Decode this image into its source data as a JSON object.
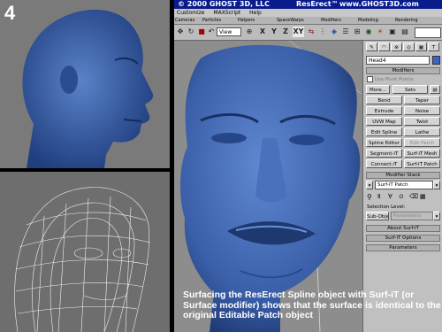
{
  "panel_number": "4",
  "window": {
    "title_left": "© 2000 GHOST 3D, LLC",
    "title_center": "ResErect™",
    "title_right": "www.GHOST3D.com"
  },
  "menu": [
    "Customize",
    "MAXScript",
    "Help"
  ],
  "tabs": [
    "Cameras",
    "Particles",
    "Helpers",
    "SpaceWarps",
    "Modifiers",
    "Modeling",
    "Rendering"
  ],
  "toolbar": {
    "view_select": "View",
    "axis_x": "X",
    "axis_y": "Y",
    "axis_z": "Z",
    "axis_xy": "XY"
  },
  "command_panel": {
    "object_name": "Head4",
    "modifiers_header": "Modifiers",
    "use_pivot_points": "Use Pivot Points",
    "more_label": "More...",
    "sets_label": "Sets",
    "modifier_buttons": [
      [
        "Bend",
        "Taper"
      ],
      [
        "Extrude",
        "Noise"
      ],
      [
        "UVW Map",
        "Twist"
      ],
      [
        "Edit Spline",
        "Lathe"
      ],
      [
        "Spline Editor",
        "Edit Patch"
      ],
      [
        "Segment-iT",
        "Surf-iT Mesh"
      ],
      [
        "Connect-iT",
        "Surf-iT Patch"
      ]
    ],
    "modifier_stack_header": "Modifier Stack",
    "stack_current": "Surf-iT Patch",
    "selection_level_label": "Selection Level:",
    "sub_object_label": "Sub-Object",
    "sub_object_value": "Parameters",
    "rollouts": [
      "About Surf-iT",
      "Surf-iT Options",
      "Parameters"
    ]
  },
  "caption": "Surfacing the ResErect Spline object with Surf-iT (or Surface modifier) shows that the surface is identical to the original Editable Patch object",
  "colors": {
    "head_blue": "#3a5fa8",
    "title_bar": "#0a1c8c",
    "viewport_gray": "#8d8d8d",
    "panel_gray": "#c0c0c0"
  }
}
